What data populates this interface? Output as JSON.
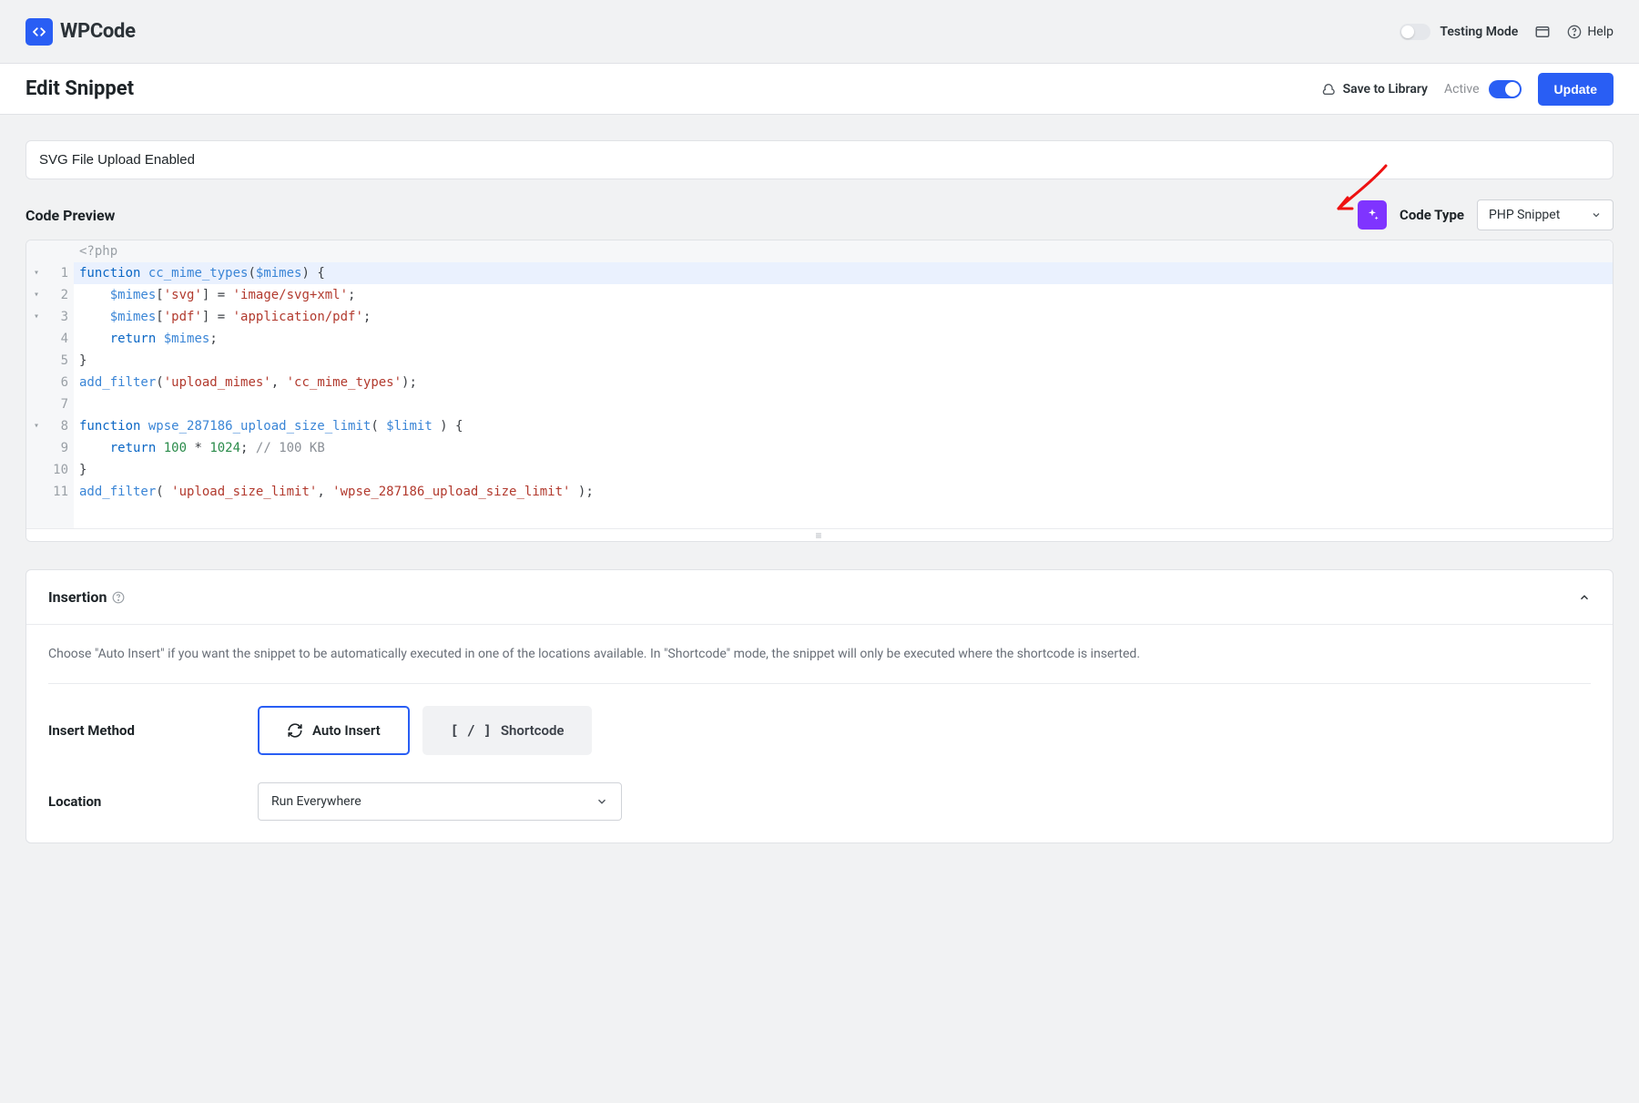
{
  "top": {
    "brand_text": "WPCode",
    "testing_mode": "Testing Mode",
    "help": "Help"
  },
  "subheader": {
    "title": "Edit Snippet",
    "save_library": "Save to Library",
    "active": "Active",
    "update": "Update"
  },
  "snippet": {
    "title": "SVG File Upload Enabled"
  },
  "preview": {
    "label": "Code Preview",
    "codetype_label": "Code Type",
    "codetype_value": "PHP Snippet"
  },
  "code": {
    "php_open": "<?php",
    "lines": [
      {
        "n": 1,
        "fold": "▾",
        "tokens": [
          [
            "kw",
            "function"
          ],
          [
            "pun",
            " "
          ],
          [
            "fn",
            "cc_mime_types"
          ],
          [
            "pun",
            "("
          ],
          [
            "var",
            "$mimes"
          ],
          [
            "pun",
            ") {"
          ]
        ]
      },
      {
        "n": 2,
        "fold": "▾",
        "tokens": [
          [
            "pun",
            "    "
          ],
          [
            "var",
            "$mimes"
          ],
          [
            "pun",
            "["
          ],
          [
            "str",
            "'svg'"
          ],
          [
            "pun",
            "] = "
          ],
          [
            "str",
            "'image/svg+xml'"
          ],
          [
            "pun",
            ";"
          ]
        ]
      },
      {
        "n": 3,
        "fold": "▾",
        "tokens": [
          [
            "pun",
            "    "
          ],
          [
            "var",
            "$mimes"
          ],
          [
            "pun",
            "["
          ],
          [
            "str",
            "'pdf'"
          ],
          [
            "pun",
            "] = "
          ],
          [
            "str",
            "'application/pdf'"
          ],
          [
            "pun",
            ";"
          ]
        ]
      },
      {
        "n": 4,
        "fold": "",
        "tokens": [
          [
            "pun",
            "    "
          ],
          [
            "kw",
            "return"
          ],
          [
            "pun",
            " "
          ],
          [
            "var",
            "$mimes"
          ],
          [
            "pun",
            ";"
          ]
        ]
      },
      {
        "n": 5,
        "fold": "",
        "tokens": [
          [
            "pun",
            "}"
          ]
        ]
      },
      {
        "n": 6,
        "fold": "",
        "tokens": [
          [
            "fn",
            "add_filter"
          ],
          [
            "pun",
            "("
          ],
          [
            "str",
            "'upload_mimes'"
          ],
          [
            "pun",
            ", "
          ],
          [
            "str",
            "'cc_mime_types'"
          ],
          [
            "pun",
            ");"
          ]
        ]
      },
      {
        "n": 7,
        "fold": "",
        "tokens": []
      },
      {
        "n": 8,
        "fold": "▾",
        "tokens": [
          [
            "kw",
            "function"
          ],
          [
            "pun",
            " "
          ],
          [
            "fn",
            "wpse_287186_upload_size_limit"
          ],
          [
            "pun",
            "( "
          ],
          [
            "var",
            "$limit"
          ],
          [
            "pun",
            " ) {"
          ]
        ]
      },
      {
        "n": 9,
        "fold": "",
        "tokens": [
          [
            "pun",
            "    "
          ],
          [
            "kw",
            "return"
          ],
          [
            "pun",
            " "
          ],
          [
            "num",
            "100"
          ],
          [
            "pun",
            " * "
          ],
          [
            "num",
            "1024"
          ],
          [
            "pun",
            "; "
          ],
          [
            "cmt",
            "// 100 KB"
          ]
        ]
      },
      {
        "n": 10,
        "fold": "",
        "tokens": [
          [
            "pun",
            "}"
          ]
        ]
      },
      {
        "n": 11,
        "fold": "",
        "tokens": [
          [
            "fn",
            "add_filter"
          ],
          [
            "pun",
            "( "
          ],
          [
            "str",
            "'upload_size_limit'"
          ],
          [
            "pun",
            ", "
          ],
          [
            "str",
            "'wpse_287186_upload_size_limit'"
          ],
          [
            "pun",
            " );"
          ]
        ]
      }
    ]
  },
  "insertion": {
    "title": "Insertion",
    "desc": "Choose \"Auto Insert\" if you want the snippet to be automatically executed in one of the locations available. In \"Shortcode\" mode, the snippet will only be executed where the shortcode is inserted.",
    "method_label": "Insert Method",
    "auto_insert": "Auto Insert",
    "shortcode": "Shortcode",
    "location_label": "Location",
    "location_value": "Run Everywhere"
  }
}
